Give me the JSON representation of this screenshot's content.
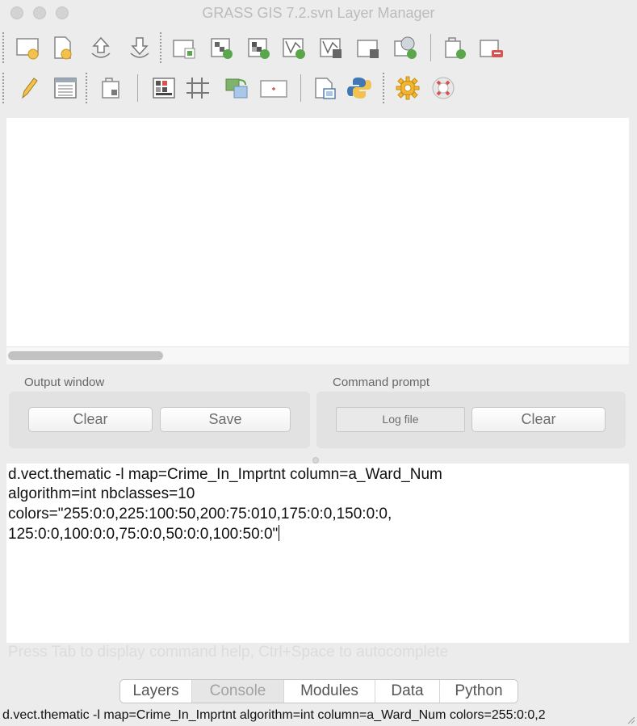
{
  "window": {
    "title": "GRASS GIS 7.2.svn Layer Manager"
  },
  "toolbar1": {
    "tools": [
      {
        "icon": "display-map-icon"
      },
      {
        "icon": "new-workspace-icon"
      },
      {
        "icon": "open-workspace-icon"
      },
      {
        "icon": "save-workspace-icon"
      },
      {
        "icon": "add-raster-icon"
      },
      {
        "icon": "add-raster-misc-icon"
      },
      {
        "icon": "add-raster-overlay-icon"
      },
      {
        "icon": "add-vector-icon"
      },
      {
        "icon": "add-vector-misc-icon"
      },
      {
        "icon": "add-group-icon"
      },
      {
        "icon": "add-web-service-icon"
      },
      {
        "icon": "add-overlay-icon"
      },
      {
        "icon": "remove-layer-icon"
      }
    ]
  },
  "toolbar2": {
    "tools": [
      {
        "icon": "edit-vector-icon"
      },
      {
        "icon": "attribute-table-icon"
      },
      {
        "icon": "georectify-icon"
      },
      {
        "icon": "modeler-icon"
      },
      {
        "icon": "grid-icon"
      },
      {
        "icon": "import-icon"
      },
      {
        "icon": "map-calculator-icon"
      },
      {
        "icon": "cartographic-composer-icon"
      },
      {
        "icon": "python-shell-icon"
      },
      {
        "icon": "settings-icon"
      },
      {
        "icon": "help-icon"
      }
    ]
  },
  "output_window": {
    "label": "Output window",
    "clear_label": "Clear",
    "save_label": "Save"
  },
  "command_prompt": {
    "label": "Command prompt",
    "logfile_label": "Log file",
    "clear_label": "Clear"
  },
  "command_editor": {
    "lines": [
      "d.vect.thematic -l map=Crime_In_Imprtnt column=a_Ward_Num",
      "algorithm=int nbclasses=10",
      "colors=\"255:0:0,225:100:50,200:75:010,175:0:0,150:0:0,",
      "125:0:0,100:0:0,75:0:0,50:0:0,100:50:0\""
    ],
    "hint": "Press Tab to display command help, Ctrl+Space to autocomplete"
  },
  "tabs": [
    {
      "label": "Layers",
      "active": false
    },
    {
      "label": "Console",
      "active": true
    },
    {
      "label": "Modules",
      "active": false
    },
    {
      "label": "Data",
      "active": false
    },
    {
      "label": "Python",
      "active": false
    }
  ],
  "statusbar": {
    "text": "d.vect.thematic -l map=Crime_In_Imprtnt algorithm=int column=a_Ward_Num colors=255:0:0,2"
  },
  "colors": {
    "window_bg": "#ececec",
    "panel_bg": "#ffffff",
    "groupbox_bg": "#e2e2e2",
    "accent_yellow": "#f2c14e",
    "accent_green": "#5aa64b",
    "accent_red": "#d9534f"
  }
}
